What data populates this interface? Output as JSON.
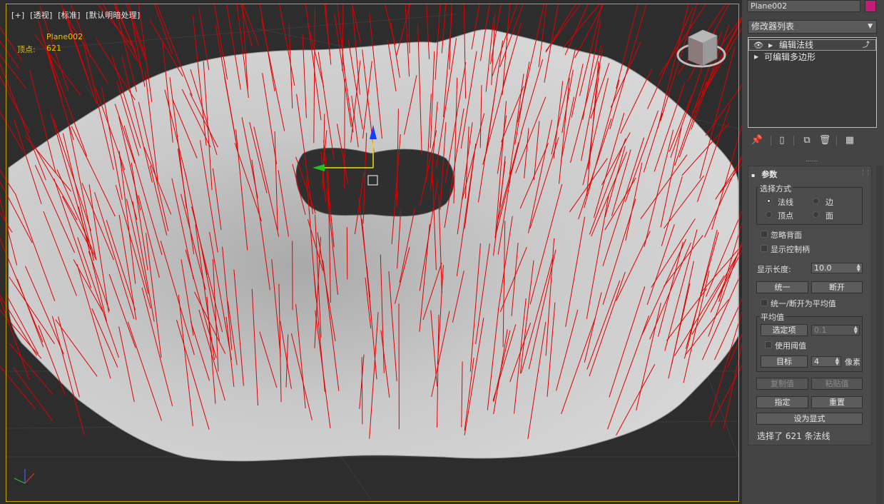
{
  "viewport": {
    "labels": [
      "[+]",
      "[透视]",
      "[标准]",
      "[默认明暗处理]"
    ],
    "object_name": "Plane002",
    "vertex_label": "顶点:",
    "vertex_count": "621"
  },
  "panel": {
    "object_name": "Plane002",
    "object_color": "#c41a78",
    "modifier_list": "修改器列表",
    "stack": [
      {
        "label": "编辑法线",
        "selected": true
      },
      {
        "label": "可编辑多边形",
        "selected": false
      }
    ],
    "rollout_title": "参数",
    "selection_group": "选择方式",
    "radio_normal": "法线",
    "radio_edge": "边",
    "radio_vertex": "顶点",
    "radio_face": "面",
    "ignore_backface": "忽略背面",
    "show_handles": "显示控制柄",
    "display_length_label": "显示长度:",
    "display_length_value": "10.0",
    "unify_btn": "统一",
    "break_btn": "断开",
    "unify_break_avg": "统一/断开为平均值",
    "average_group": "平均值",
    "selected_btn": "选定项",
    "selected_value": "0.1",
    "use_threshold": "使用阈值",
    "target_btn": "目标",
    "target_value": "4",
    "pixels_label": "像素",
    "copy_btn": "复制值",
    "paste_btn": "粘贴值",
    "specify_btn": "指定",
    "reset_btn": "重置",
    "make_explicit_btn": "设为显式",
    "status": "选择了 621 条法线"
  }
}
